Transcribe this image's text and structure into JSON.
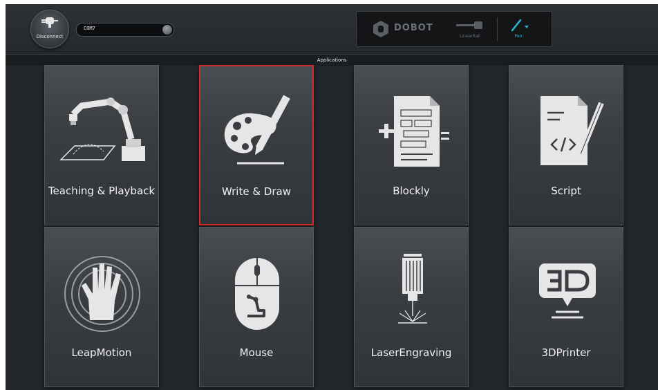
{
  "topbar": {
    "disconnect_label": "Disconnect",
    "port_value": "COM7",
    "brand": "DOBOT",
    "linear_rail_label": "LinearRail",
    "end_tool_label": "Pen"
  },
  "section_title": "Applications",
  "colors": {
    "accent": "#29b6d9",
    "selected_border": "#d22b2b",
    "background": "#23272b"
  },
  "tiles": [
    {
      "label": "Teaching & Playback",
      "icon": "robot-arm-icon",
      "selected": false
    },
    {
      "label": "Write & Draw",
      "icon": "palette-pencil-icon",
      "selected": true
    },
    {
      "label": "Blockly",
      "icon": "blockly-document-icon",
      "selected": false
    },
    {
      "label": "Script",
      "icon": "script-document-icon",
      "selected": false
    },
    {
      "label": "LeapMotion",
      "icon": "hand-icon",
      "selected": false
    },
    {
      "label": "Mouse",
      "icon": "mouse-icon",
      "selected": false
    },
    {
      "label": "LaserEngraving",
      "icon": "laser-icon",
      "selected": false
    },
    {
      "label": "3DPrinter",
      "icon": "3d-printer-icon",
      "selected": false
    }
  ]
}
